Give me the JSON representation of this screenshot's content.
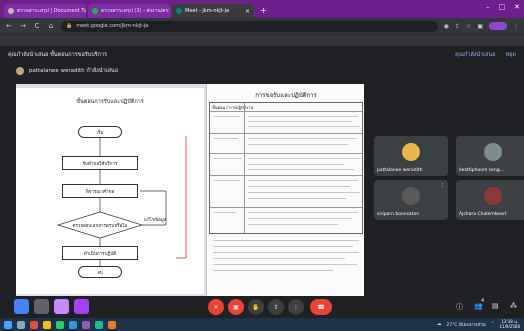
{
  "browser": {
    "tabs": [
      {
        "title": "ตรวจสาระสรุป | Document Tutor - ...",
        "active": false
      },
      {
        "title": "ตรวจสาระสรุป (3) - ส่งงาน/ตรวจ",
        "active": false
      },
      {
        "title": "Meet - jkm-nkjt-ja",
        "active": true
      }
    ],
    "new_tab": "+",
    "window_controls": [
      "–",
      "□",
      "✕"
    ],
    "url": "meet.google.com/jkm-nkjt-ja",
    "back": "←",
    "forward": "→",
    "reload": "C",
    "home": "⌂"
  },
  "meet": {
    "title": "คุณกำลังนำเสนอ ขั้นตอนการขอรับบริการ",
    "top_right": [
      "คุณกำลังนำเสนอ",
      "หยุด"
    ],
    "presenter_label": "pattalanee weradith กำลังนำเสนอ"
  },
  "shared": {
    "flow_title": "ขั้นตอนการรับและปฏิบัติการ",
    "flow_nodes": [
      "เริ่ม",
      "รับคำขอใช้บริการ",
      "พิจารณาคำขอ",
      "ตรวจสอบเอกสารครบหรือไม่",
      "ดำเนินการปฏิบัติ",
      "จบ"
    ],
    "flow_side": "แก้ไขข้อมูล",
    "doc_title": "การขอรับและปฏิบัติการ",
    "doc_table_header": "ขั้นตอน / การปฏิบัติงาน"
  },
  "participants": [
    {
      "name": "pattalanee weradith",
      "color": "#e8b84a"
    },
    {
      "name": "keattiphoom seng...",
      "color": "#c0392b"
    },
    {
      "name": "siriporn boonsaton",
      "color": "#5a5a5a"
    },
    {
      "name": "Ajchara Chalernkeart",
      "color": "#8b3a3a"
    }
  ],
  "controls": {
    "left": [
      {
        "label": "",
        "color": "#4285f4"
      },
      {
        "label": "",
        "color": "#5f6368"
      },
      {
        "label": "",
        "color": "#c58af9"
      },
      {
        "label": "",
        "color": "#a142f4"
      }
    ],
    "center_icons": [
      "mic-off",
      "video",
      "hand",
      "present",
      "more",
      "end-call"
    ],
    "right_counts": {
      "people": "4"
    }
  },
  "taskbar": {
    "weather": "27°C มีเมฆบางส่วน",
    "time": "13:18 น.",
    "date": "11/9/2566"
  }
}
